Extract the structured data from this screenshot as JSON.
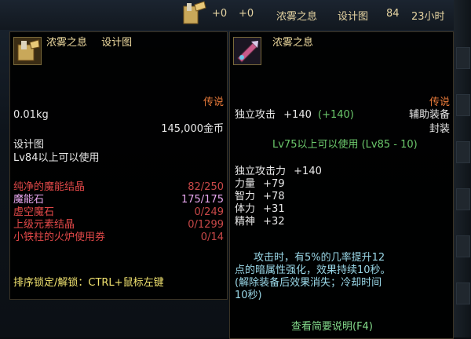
{
  "top_bar": {
    "stat1": "+0",
    "stat2": "+0",
    "item_name": "浓雾之息",
    "item_type": "设计图",
    "level": "84",
    "time": "23小时"
  },
  "left_tooltip": {
    "title_name": "浓雾之息",
    "title_type": "设计图",
    "rarity": "传说",
    "weight": "0.01kg",
    "price": "145,000金币",
    "category": "设计图",
    "requirement": "Lv84以上可以使用",
    "materials": [
      {
        "name": "纯净的魔能结晶",
        "count": "82/250",
        "color": "red"
      },
      {
        "name": "魔能石",
        "count": "175/175",
        "color": "lavender"
      },
      {
        "name": "虚空魔石",
        "count": "0/249",
        "color": "red"
      },
      {
        "name": "上级元素结晶",
        "count": "0/1299",
        "color": "red"
      },
      {
        "name": "小铁柱的火炉使用券",
        "count": "0/14",
        "color": "red"
      }
    ],
    "hint": "排序锁定/解锁：CTRL+鼠标左键"
  },
  "right_tooltip": {
    "title_name": "浓雾之息",
    "rarity": "传说",
    "attack_label": "独立攻击",
    "attack_value": "+140",
    "attack_bonus": "(+140)",
    "equip_type": "辅助装备",
    "sealed": "封装",
    "requirement": "Lv75以上可以使用 (Lv85 - 10)",
    "stats": [
      {
        "name": "独立攻击力",
        "value": "+140"
      },
      {
        "name": "力量",
        "value": "+79"
      },
      {
        "name": "智力",
        "value": "+78"
      },
      {
        "name": "体力",
        "value": "+31"
      },
      {
        "name": "精神",
        "value": "+32"
      }
    ],
    "effect_lines": [
      "攻击时，有5%的几率提升12",
      "点的暗属性强化，效果持续10秒。",
      "(解除装备后效果消失；冷却时间",
      "10秒)"
    ],
    "footer_link": "查看简要说明(F4)"
  }
}
